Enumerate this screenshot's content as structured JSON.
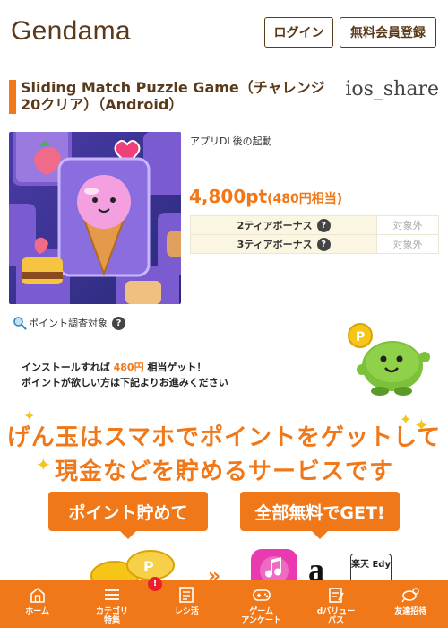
{
  "header": {
    "logo": "Gendama",
    "login_label": "ログイン",
    "register_label": "無料会員登録"
  },
  "offer": {
    "title": "Sliding Match Puzzle Game（チャレンジ20クリア）（Android）",
    "platform": "ios_share",
    "description": "アプリDL後の起動",
    "points": "4,800pt",
    "yen": "(480円相当)",
    "bonus_rows": [
      {
        "label": "2ティアボーナス",
        "help": "?",
        "value": "対象外"
      },
      {
        "label": "3ティアボーナス",
        "help": "?",
        "value": "対象外"
      }
    ],
    "survey_label": "ポイント調査対象",
    "survey_help": "?"
  },
  "install": {
    "line1_prefix": "インストールすれば ",
    "line1_highlight": "480円",
    "line1_suffix": " 相当ゲット！",
    "line2": "ポイントが欲しい方は下記よりお進みください"
  },
  "promo": {
    "line1": "げん玉はスマホでポイントをゲットして",
    "line2": "現金などを貯めるサービスです",
    "btn_left": "ポイント貯めて",
    "btn_right": "全部無料でGET!",
    "amazon_mark": "a",
    "edy_label": "楽天 Edy"
  },
  "nav": {
    "badge": "!",
    "items": [
      {
        "label": "ホーム",
        "icon": "home-icon"
      },
      {
        "label": "カテゴリ\n特集",
        "icon": "menu-icon"
      },
      {
        "label": "レシ活",
        "icon": "receipt-icon"
      },
      {
        "label": "ゲーム\nアンケート",
        "icon": "gamepad-icon"
      },
      {
        "label": "dバリュー\nパス",
        "icon": "notepad-icon"
      },
      {
        "label": "友達招待",
        "icon": "invite-icon"
      }
    ]
  },
  "colors": {
    "accent": "#f07818",
    "brand_text": "#5a3a1a",
    "bonus_bg": "#fbf6e2"
  }
}
